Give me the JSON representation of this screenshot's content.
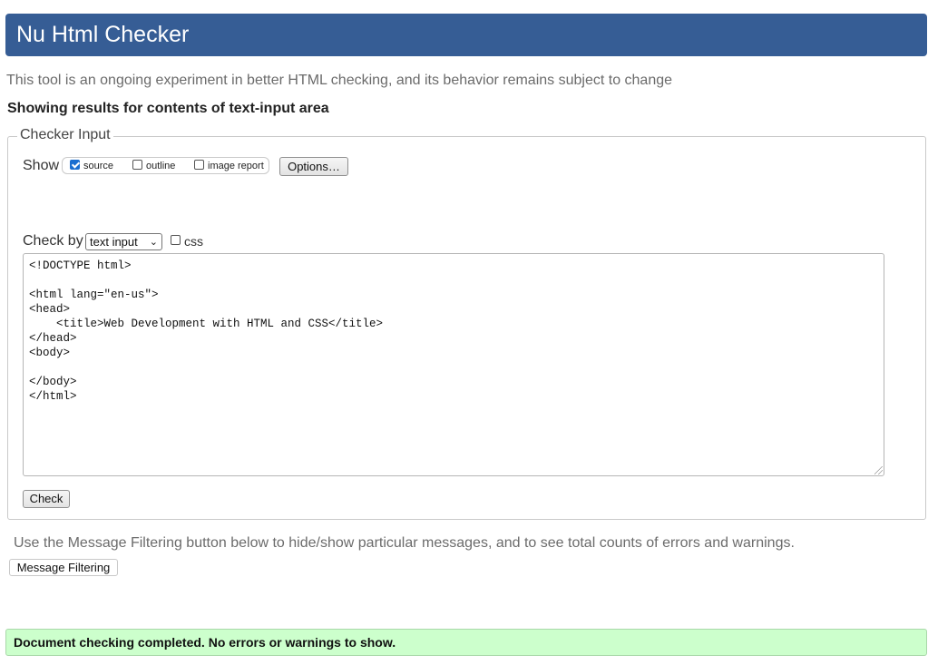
{
  "header": {
    "title": "Nu Html Checker"
  },
  "subtitle": "This tool is an ongoing experiment in better HTML checking, and its behavior remains subject to change",
  "results_heading": "Showing results for contents of text-input area",
  "checker_input": {
    "legend": "Checker Input",
    "show_label": "Show",
    "show_options": [
      {
        "label": "source",
        "checked": true
      },
      {
        "label": "outline",
        "checked": false
      },
      {
        "label": "image report",
        "checked": false
      }
    ],
    "options_button": "Options…",
    "check_by_label": "Check by",
    "check_by_value": "text input",
    "css_label": "css",
    "css_checked": false,
    "source_code": "<!DOCTYPE html>\n\n<html lang=\"en-us\">\n<head>\n    <title>Web Development with HTML and CSS</title>\n</head>\n<body>\n\n</body>\n</html>",
    "check_button": "Check"
  },
  "filter_note": "Use the Message Filtering button below to hide/show particular messages, and to see total counts of errors and warnings.",
  "message_filtering_button": "Message Filtering",
  "status_message": "Document checking completed. No errors or warnings to show.",
  "colors": {
    "header_bg": "#365d95",
    "success_bg": "#ccffcc"
  }
}
